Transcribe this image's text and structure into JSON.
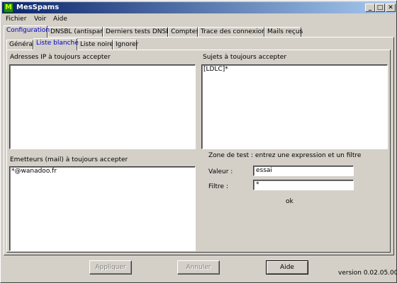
{
  "window": {
    "title": "MesSpams",
    "icon": "messpams-app-icon",
    "icon_glyph": "M"
  },
  "menu": {
    "items": [
      "Fichier",
      "Voir",
      "Aide"
    ]
  },
  "tabs": {
    "main": [
      "Configuration",
      "DNSBL (antispam)",
      "Derniers tests DNSBL",
      "Comptes",
      "Trace des connexions",
      "Mails reçus"
    ],
    "main_active": "Configuration",
    "sub": [
      "Général",
      "Liste blanche",
      "Liste noire",
      "Ignorer"
    ],
    "sub_active": "Liste blanche",
    "active_color": "#0000c0"
  },
  "liste_blanche": {
    "ip_label": "Adresses IP à toujours accepter",
    "ip_items": [],
    "subjects_label": "Sujets à toujours accepter",
    "subjects_items": [
      "[LDLC]*"
    ],
    "senders_label": "Emetteurs (mail) à toujours accepter",
    "senders_items": [
      "*@wanadoo.fr"
    ]
  },
  "test_zone": {
    "title": "Zone de test : entrez une expression et un filtre",
    "valeur_label": "Valeur :",
    "valeur_value": "essai",
    "filtre_label": "Filtre :",
    "filtre_value": "*",
    "result": "ok"
  },
  "buttons": {
    "appliquer": "Appliquer",
    "annuler": "Annuler",
    "aide": "Aide"
  },
  "version": "version 0.02.05.00"
}
